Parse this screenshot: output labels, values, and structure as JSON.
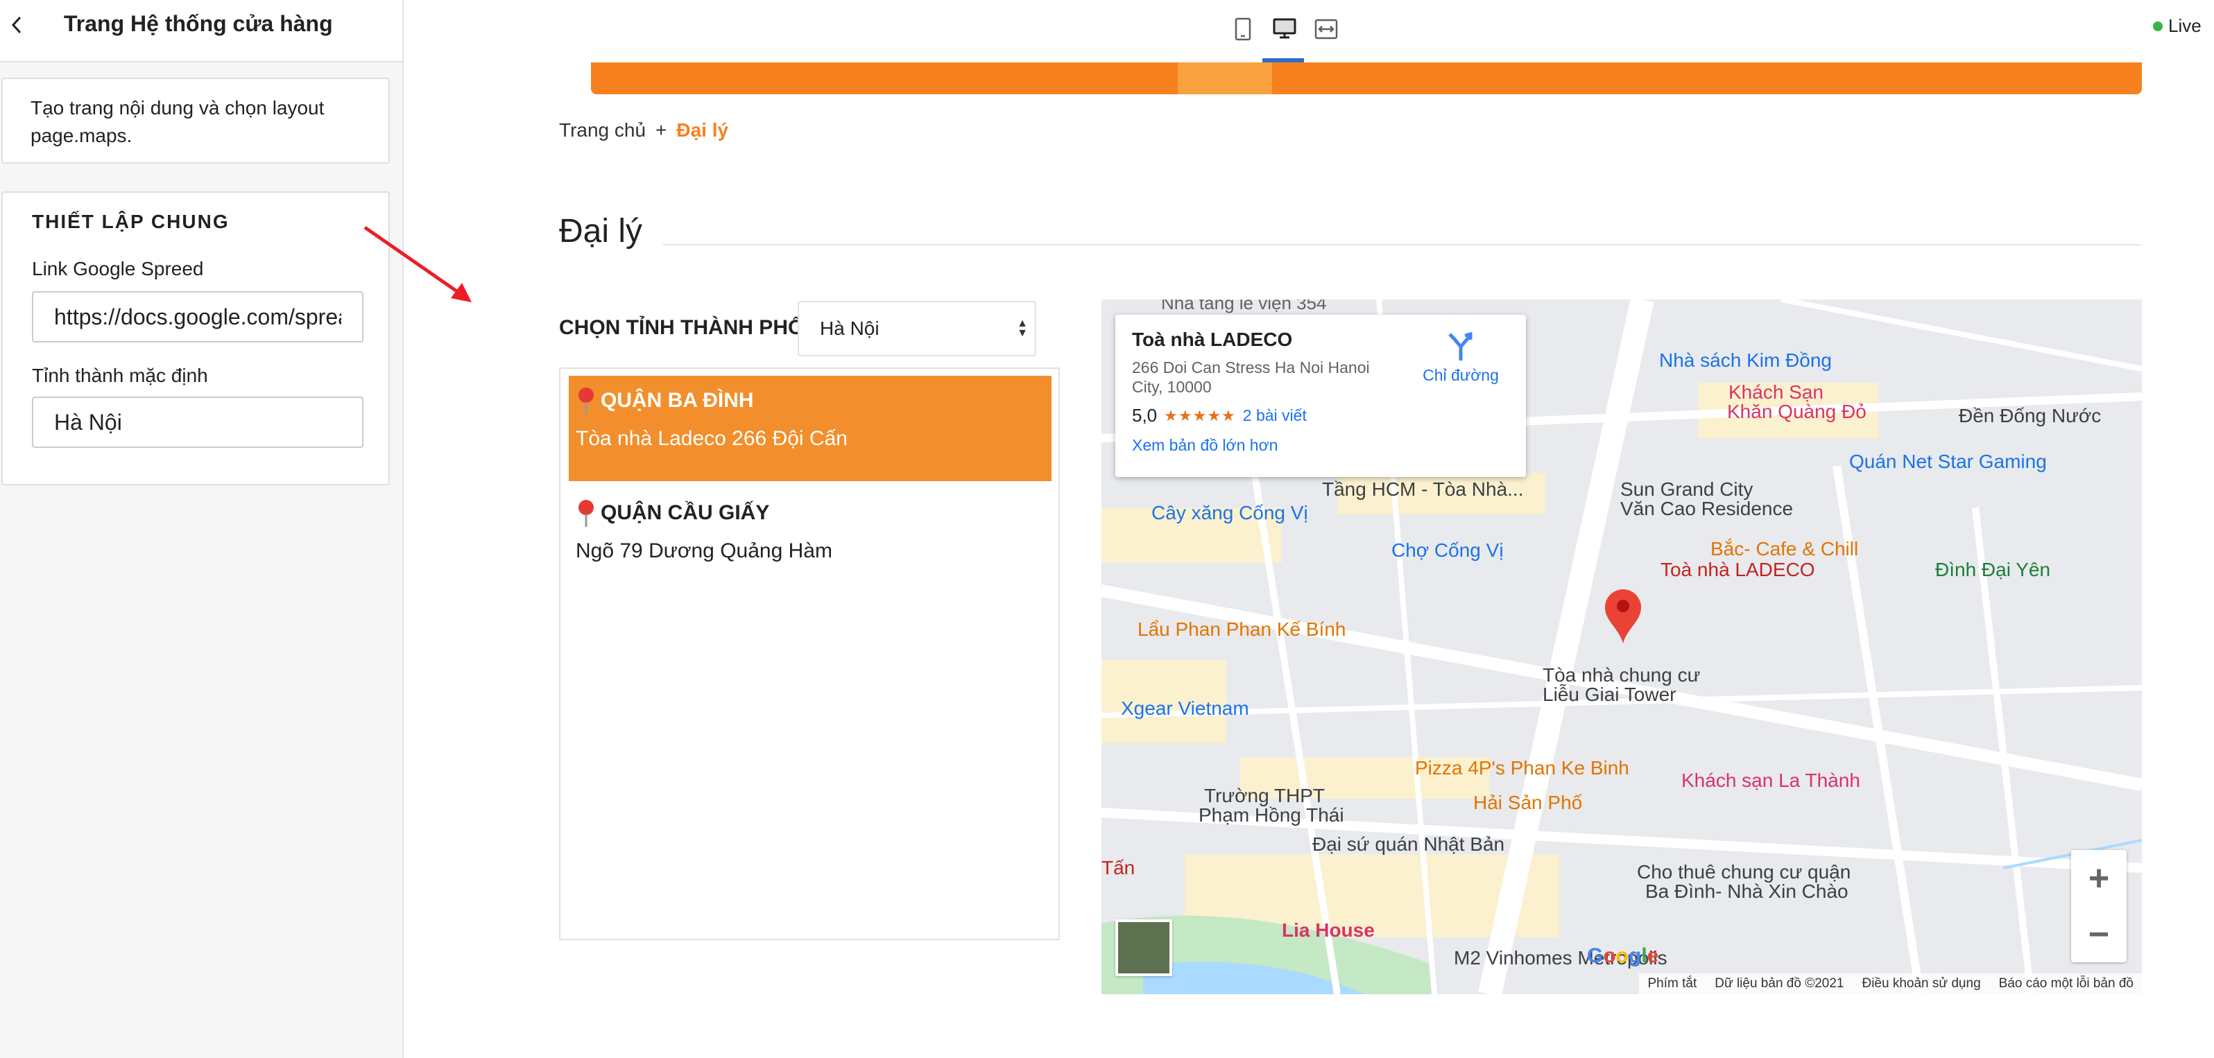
{
  "sidebar": {
    "title": "Trang Hệ thống cửa hàng",
    "description": "Tạo trang nội dung và chọn layout page.maps.",
    "section_title": "THIẾT LẬP CHUNG",
    "field1_label": "Link Google Spreed",
    "field1_value": "https://docs.google.com/spreadsheets",
    "field2_label": "Tỉnh thành mặc định",
    "field2_value": "Hà Nội"
  },
  "topbar": {
    "devices": [
      "mobile-icon",
      "desktop-icon",
      "fullwidth-icon"
    ],
    "live_label": "Live",
    "live_color": "#39b54a"
  },
  "preview": {
    "breadcrumb": {
      "home": "Trang chủ",
      "separator": "+",
      "current": "Đại lý"
    },
    "page_title": "Đại lý",
    "province_label": "CHỌN TỈNH THÀNH PHỐ",
    "province_selected": "Hà Nội",
    "stores": [
      {
        "name": "QUẬN BA ĐÌNH",
        "address": "Tòa nhà Ladeco 266 Đội Cấn",
        "active": true
      },
      {
        "name": "QUẬN CẦU GIẤY",
        "address": "Ngõ 79 Dương Quảng Hàm",
        "active": false
      }
    ],
    "accent_color": "#f7811f"
  },
  "map": {
    "info": {
      "title": "Toà nhà LADECO",
      "address": "266 Doi Can Stress Ha Noi Hanoi City, 10000",
      "rating": "5,0",
      "stars": "★★★★★",
      "reviews": "2 bài viết",
      "directions": "Chỉ đường",
      "larger_map": "Xem bản đồ lớn hơn"
    },
    "marker_label": "Toà nhà LADECO",
    "labels": {
      "l1": "Nhà sách Kim Đồng",
      "l2": "Khách Sạn",
      "l2b": "Khăn Quàng Đỏ",
      "l3": "Đền Đống Nước",
      "l4": "Quán Net Star Gaming",
      "l5": "Sun Grand City",
      "l5b": "Văn Cao Residence",
      "l6": "Cây xăng Cống Vị",
      "l7": "Chợ Cống Vị",
      "l8": "Bắc- Cafe & Chill",
      "l9": "Đình Đại Yên",
      "l10": "Lẩu Phan Phan Kế Bính",
      "l11": "Tòa nhà chung cư",
      "l11b": "Liễu Giai Tower",
      "l12": "Xgear Vietnam",
      "l13": "Pizza 4P's Phan Ke Binh",
      "l14": "Khách sạn La Thành",
      "l15": "Trường THPT",
      "l15b": "Phạm Hồng Thái",
      "l16": "Hải Sản Phố",
      "l17": "Đại sứ quán Nhật Bản",
      "l18": "Cho thuê chung cư quận",
      "l18b": "Ba Đình- Nhà Xin Chào",
      "l19": "Lia House",
      "l20": "M2 Vinhomes Metropolis",
      "l21": "Nhà tang lễ viện 354",
      "l22": "Tầng HCM - Tòa Nhà...",
      "l23": "Tấn"
    },
    "attribution": [
      "Phím tắt",
      "Dữ liệu bản đồ ©2021",
      "Điều khoản sử dụng",
      "Báo cáo một lỗi bản đồ"
    ],
    "logo": "Google"
  }
}
